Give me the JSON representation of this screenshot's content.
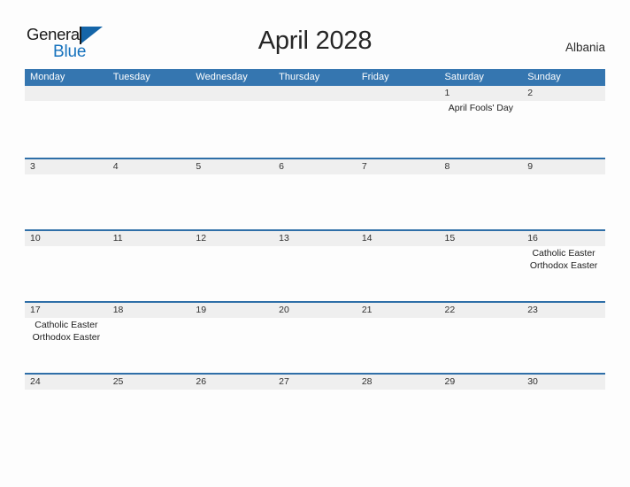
{
  "brand": {
    "name_part1": "General",
    "name_part2": "Blue",
    "flag_icon": "flag-triangle-icon",
    "color_dark": "#1a1a1a",
    "color_blue": "#1672bd"
  },
  "header": {
    "title": "April 2028",
    "country": "Albania"
  },
  "theme": {
    "header_blue": "#3576b0",
    "row_rule_blue": "#2f6fa8",
    "day_band_gray": "#efefef",
    "page_background": "#fdfdfd",
    "text": "#222222"
  },
  "calendar": {
    "weekdays": [
      "Monday",
      "Tuesday",
      "Wednesday",
      "Thursday",
      "Friday",
      "Saturday",
      "Sunday"
    ],
    "weeks": [
      [
        {
          "day": "",
          "events": []
        },
        {
          "day": "",
          "events": []
        },
        {
          "day": "",
          "events": []
        },
        {
          "day": "",
          "events": []
        },
        {
          "day": "",
          "events": []
        },
        {
          "day": "1",
          "events": [
            "April Fools' Day"
          ]
        },
        {
          "day": "2",
          "events": []
        }
      ],
      [
        {
          "day": "3",
          "events": []
        },
        {
          "day": "4",
          "events": []
        },
        {
          "day": "5",
          "events": []
        },
        {
          "day": "6",
          "events": []
        },
        {
          "day": "7",
          "events": []
        },
        {
          "day": "8",
          "events": []
        },
        {
          "day": "9",
          "events": []
        }
      ],
      [
        {
          "day": "10",
          "events": []
        },
        {
          "day": "11",
          "events": []
        },
        {
          "day": "12",
          "events": []
        },
        {
          "day": "13",
          "events": []
        },
        {
          "day": "14",
          "events": []
        },
        {
          "day": "15",
          "events": []
        },
        {
          "day": "16",
          "events": [
            "Catholic Easter",
            "Orthodox Easter"
          ]
        }
      ],
      [
        {
          "day": "17",
          "events": [
            "Catholic Easter",
            "Orthodox Easter"
          ]
        },
        {
          "day": "18",
          "events": []
        },
        {
          "day": "19",
          "events": []
        },
        {
          "day": "20",
          "events": []
        },
        {
          "day": "21",
          "events": []
        },
        {
          "day": "22",
          "events": []
        },
        {
          "day": "23",
          "events": []
        }
      ],
      [
        {
          "day": "24",
          "events": []
        },
        {
          "day": "25",
          "events": []
        },
        {
          "day": "26",
          "events": []
        },
        {
          "day": "27",
          "events": []
        },
        {
          "day": "28",
          "events": []
        },
        {
          "day": "29",
          "events": []
        },
        {
          "day": "30",
          "events": []
        }
      ]
    ]
  }
}
